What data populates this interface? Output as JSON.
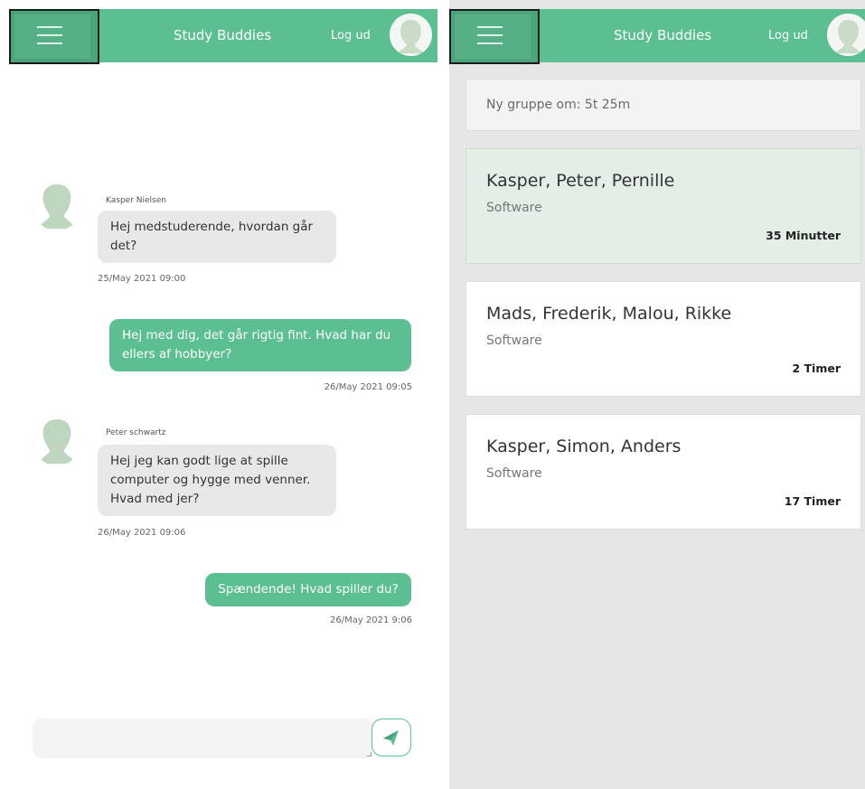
{
  "app": {
    "title": "Study Buddies",
    "logout_label": "Log ud",
    "accent_color": "#5cbf91"
  },
  "chat": {
    "messages": [
      {
        "direction": "incoming",
        "sender": "Kasper Nielsen",
        "text": "Hej medstuderende, hvordan går det?",
        "time": "25/May 2021 09:00"
      },
      {
        "direction": "outgoing",
        "text": "Hej med dig, det går rigtig fint. Hvad har du ellers af hobbyer?",
        "time": "26/May 2021 09:05"
      },
      {
        "direction": "incoming",
        "sender": "Peter schwartz",
        "text": "Hej jeg kan godt lige at spille computer og hygge med venner. Hvad med jer?",
        "time": "26/May 2021 09:06"
      },
      {
        "direction": "outgoing",
        "text": "Spændende! Hvad spiller du?",
        "time": "26/May 2021 9:06"
      }
    ],
    "input_value": "",
    "send_icon": "paper-plane-icon"
  },
  "groups": {
    "next_group_label": "Ny gruppe om: 5t 25m",
    "items": [
      {
        "members": "Kasper, Peter, Pernille",
        "subject": "Software",
        "duration": "35 Minutter",
        "active": true
      },
      {
        "members": "Mads, Frederik, Malou, Rikke",
        "subject": "Software",
        "duration": "2 Timer",
        "active": false
      },
      {
        "members": "Kasper, Simon, Anders",
        "subject": "Software",
        "duration": "17 Timer",
        "active": false
      }
    ]
  },
  "icons": {
    "menu": "hamburger-menu-icon",
    "avatar": "user-avatar-icon",
    "send": "paper-plane-icon"
  }
}
